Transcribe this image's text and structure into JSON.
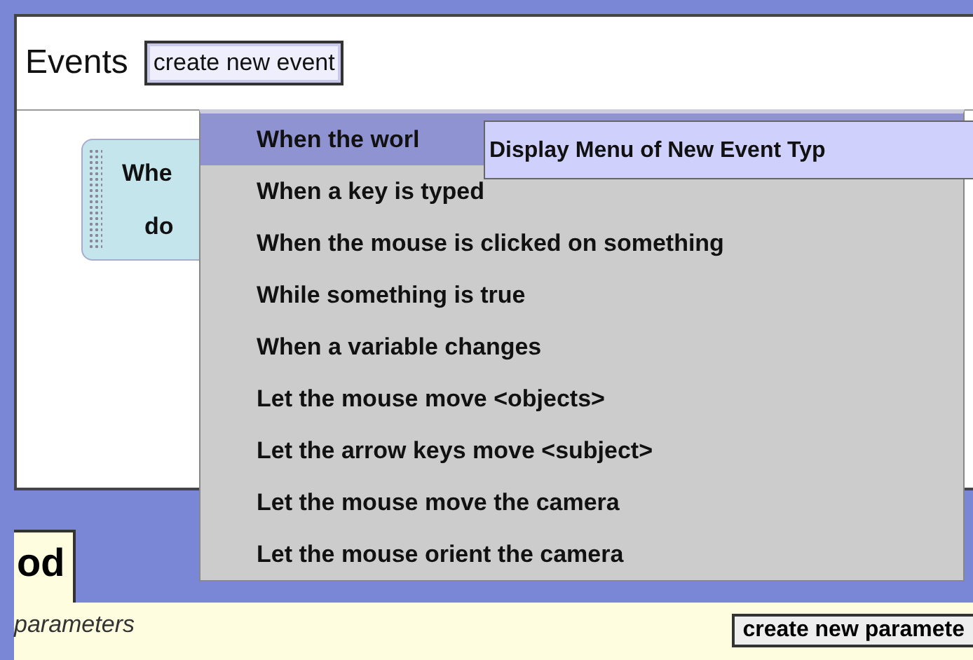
{
  "header": {
    "title": "Events",
    "button": "create new event"
  },
  "event_block": {
    "lines": [
      "Whe",
      "do"
    ]
  },
  "menu": {
    "items": [
      {
        "label": "When the worl",
        "selected": true
      },
      {
        "label": "When a key is typed",
        "selected": false
      },
      {
        "label": "When the mouse is clicked on something",
        "selected": false
      },
      {
        "label": "While something is true",
        "selected": false
      },
      {
        "label": "When a variable changes",
        "selected": false
      },
      {
        "label": "Let the mouse move <objects>",
        "selected": false
      },
      {
        "label": "Let the arrow keys move <subject>",
        "selected": false
      },
      {
        "label": "Let the mouse move the camera",
        "selected": false
      },
      {
        "label": "Let the mouse orient the camera",
        "selected": false
      }
    ]
  },
  "tooltip": "Display Menu of New Event Typ",
  "bottom": {
    "tab": "od",
    "parameters_label": "parameters",
    "button": "create new paramete"
  }
}
